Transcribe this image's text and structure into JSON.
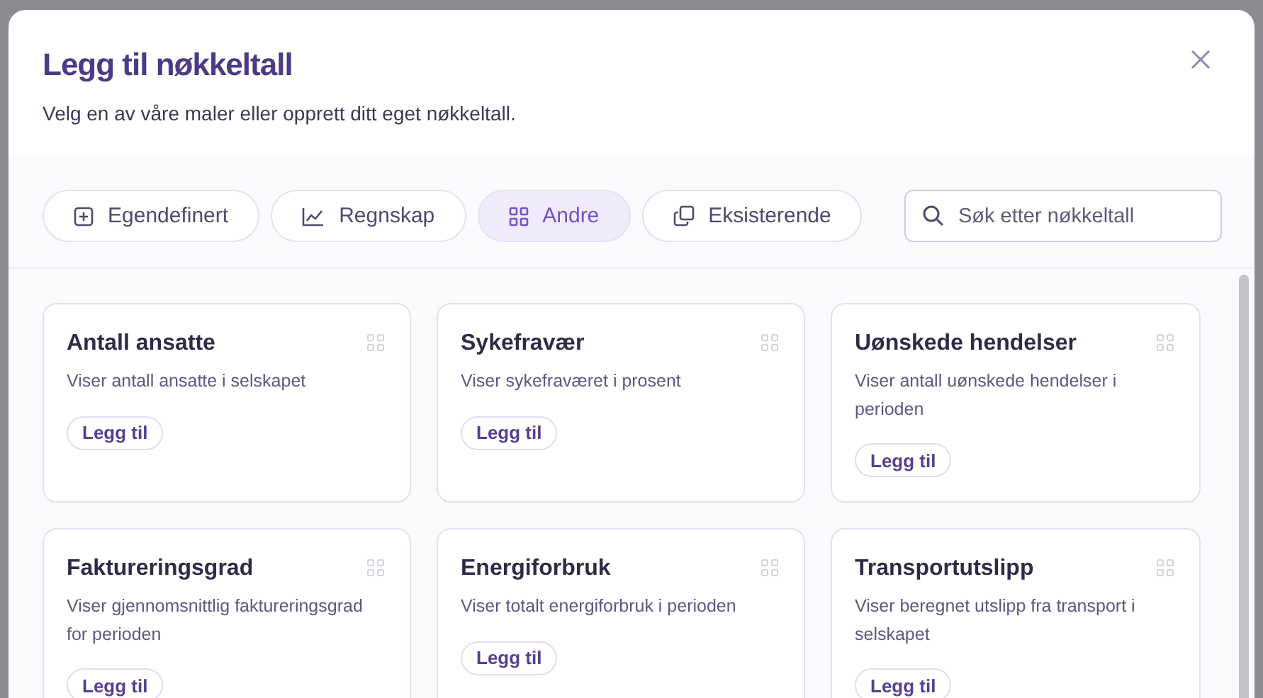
{
  "dialog": {
    "title": "Legg til nøkkeltall",
    "subtitle": "Velg en av våre maler eller opprett ditt eget nøkkeltall."
  },
  "tabs": [
    {
      "label": "Egendefinert",
      "kind": "custom",
      "selected": false
    },
    {
      "label": "Regnskap",
      "kind": "accounting",
      "selected": false
    },
    {
      "label": "Andre",
      "kind": "other",
      "selected": true
    },
    {
      "label": "Eksisterende",
      "kind": "existing",
      "selected": false
    }
  ],
  "search": {
    "placeholder": "Søk etter nøkkeltall"
  },
  "cards": [
    {
      "title": "Antall ansatte",
      "description": "Viser antall ansatte i selskapet",
      "button": "Legg til"
    },
    {
      "title": "Sykefravær",
      "description": "Viser sykefraværet i prosent",
      "button": "Legg til"
    },
    {
      "title": "Uønskede hendelser",
      "description": "Viser antall uønskede hendelser i perioden",
      "button": "Legg til"
    },
    {
      "title": "Faktureringsgrad",
      "description": "Viser gjennomsnittlig faktureringsgrad for perioden",
      "button": "Legg til"
    },
    {
      "title": "Energiforbruk",
      "description": "Viser totalt energiforbruk i perioden",
      "button": "Legg til"
    },
    {
      "title": "Transportutslipp",
      "description": "Viser beregnet utslipp fra transport i selskapet",
      "button": "Legg til"
    }
  ]
}
